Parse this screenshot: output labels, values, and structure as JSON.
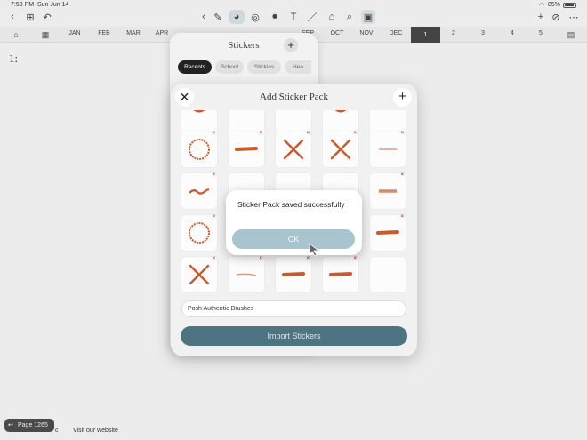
{
  "status": {
    "time": "7:53 PM",
    "date": "Sun Jun 14",
    "battery": "85%"
  },
  "months": [
    "JAN",
    "FEB",
    "MAR",
    "APR",
    "SEP",
    "OCT",
    "NOV",
    "DEC"
  ],
  "numbers": [
    "1",
    "2",
    "3",
    "4",
    "5"
  ],
  "page_label": "1:",
  "stickers_panel": {
    "title": "Stickers",
    "add": "+",
    "chips": [
      "Recents",
      "School",
      "Stickies",
      "Hea"
    ]
  },
  "modal": {
    "title": "Add Sticker Pack",
    "close": "✕",
    "add": "+",
    "pack_name": "Posh Authentic Brushes",
    "import_label": "Import Stickers"
  },
  "alert": {
    "message": "Sticker Pack saved successfully",
    "ok_label": "OK"
  },
  "footer": {
    "page": "Page 1265",
    "link": "Visit our website",
    "fragment": "c"
  },
  "colors": {
    "accent": "#4e7482",
    "ok": "#a7c4cf",
    "sticker": "#c85a2c"
  }
}
